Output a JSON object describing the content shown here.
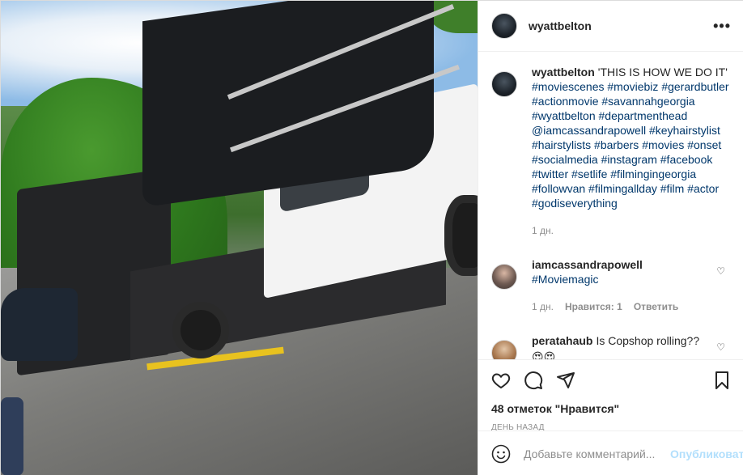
{
  "colors": {
    "link": "#00376b",
    "muted": "#8e8e8e",
    "text": "#262626",
    "post_disabled": "#b2dffc"
  },
  "post": {
    "photo_icon": "movie-truck-photo",
    "author": "wyattbelton",
    "more_icon": "more-options-icon"
  },
  "caption": {
    "author": "wyattbelton",
    "text": "'THIS IS HOW WE DO IT'",
    "tags": [
      "#moviescenes",
      "#moviebiz",
      "#gerardbutler",
      "#actionmovie",
      "#savannahgeorgia",
      "#wyattbelton",
      "#departmenthead",
      "@iamcassandrapowell",
      "#keyhairstylist",
      "#hairstylists",
      "#barbers",
      "#movies",
      "#onset",
      "#socialmedia",
      "#instagram",
      "#facebook",
      "#twitter",
      "#setlife",
      "#filmingingeorgia",
      "#followvan",
      "#filmingallday",
      "#film",
      "#actor",
      "#godiseverything"
    ],
    "time": "1 дн."
  },
  "comments": [
    {
      "author": "iamcassandrapowell",
      "text": "",
      "tag": "#Moviemagic",
      "time": "1 дн.",
      "likes": "Нравится: 1",
      "reply": "Ответить"
    },
    {
      "author": "peratahaub",
      "text": "Is Copshop rolling??",
      "emoji": "😍😍"
    }
  ],
  "actions": {
    "likes_label": "48 отметок \"Нравится\"",
    "date_label": "день назад"
  },
  "add_comment": {
    "placeholder": "Добавьте комментарий...",
    "post_label": "Опубликовать"
  }
}
